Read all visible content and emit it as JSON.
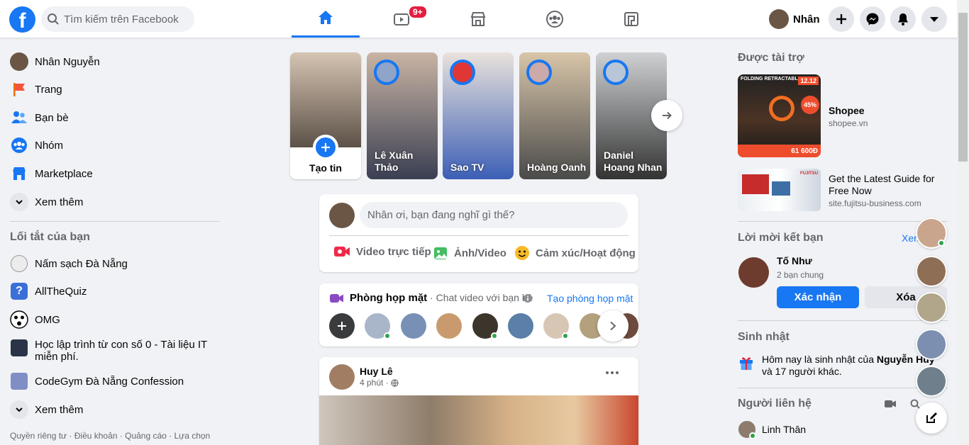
{
  "topbar": {
    "logo": "f",
    "search_placeholder": "Tìm kiếm trên Facebook",
    "video_badge": "9+",
    "user_short_name": "Nhân",
    "tabs": [
      "home-icon",
      "watch-icon",
      "marketplace-icon",
      "groups-icon",
      "gaming-icon"
    ],
    "actions": [
      "plus-icon",
      "messenger-icon",
      "bell-icon",
      "caret-down-icon"
    ]
  },
  "left_nav": {
    "items": [
      {
        "label": "Nhân Nguyễn",
        "icon": "avatar"
      },
      {
        "label": "Trang",
        "icon": "flag-icon"
      },
      {
        "label": "Bạn bè",
        "icon": "friends-icon"
      },
      {
        "label": "Nhóm",
        "icon": "groups-icon"
      },
      {
        "label": "Marketplace",
        "icon": "store-icon"
      },
      {
        "label": "Xem thêm",
        "icon": "chevron-down-icon"
      }
    ],
    "shortcuts_title": "Lối tắt của bạn",
    "shortcuts": [
      {
        "label": "Nấm sạch Đà Nẵng"
      },
      {
        "label": "AllTheQuiz"
      },
      {
        "label": "OMG"
      },
      {
        "label": "Học lập trình từ con số 0 - Tài liệu IT miễn phí."
      },
      {
        "label": "CodeGym Đà Nẵng Confession"
      },
      {
        "label": "Xem thêm"
      }
    ],
    "footer": "Quyền riêng tư · Điều khoản · Quảng cáo · Lựa chọn"
  },
  "stories": [
    {
      "name": "Tạo tin"
    },
    {
      "name": "Lê Xuân Thảo"
    },
    {
      "name": "Sao TV"
    },
    {
      "name": "Hoàng Oanh"
    },
    {
      "name": "Daniel Hoang Nhan"
    }
  ],
  "composer": {
    "placeholder": "Nhân ơi, bạn đang nghĩ gì thế?",
    "actions": [
      {
        "label": "Video trực tiếp",
        "color": "#f02849"
      },
      {
        "label": "Ảnh/Video",
        "color": "#45bd62"
      },
      {
        "label": "Cảm xúc/Hoạt động",
        "color": "#f7b928"
      }
    ]
  },
  "rooms": {
    "title": "Phòng họp mặt",
    "subtitle": " · Chat video với bạn bè",
    "create_link": "Tạo phòng họp mặt"
  },
  "post": {
    "author": "Huy Lê",
    "time": "4 phút ·"
  },
  "right": {
    "sponsored_title": "Được tài trợ",
    "ads": [
      {
        "title": "Shopee",
        "domain": "shopee.vn",
        "image_text": "FOLDING RETRACTABLE LED L",
        "date": "12.12",
        "discount": "45%",
        "price": "61 600Đ"
      },
      {
        "title": "Get the Latest Guide for Free Now",
        "domain": "site.fujitsu-business.com",
        "brand": "FUJITSU"
      }
    ],
    "friend_requests_title": "Lời mời kết bạn",
    "see_all": "Xem",
    "request": {
      "name": "Tố Như",
      "mutual": "2 bạn chung",
      "confirm": "Xác nhận",
      "delete": "Xóa"
    },
    "birthday_title": "Sinh nhật",
    "birthday_prefix": "Hôm nay là sinh nhật của ",
    "birthday_name": "Nguyễn Huy",
    "birthday_suffix": " và 17 người khác.",
    "contacts_title": "Người liên hệ",
    "contacts": [
      {
        "name": "Linh Thân"
      }
    ]
  },
  "colors": {
    "brand": "#1877f2",
    "bg": "#f0f2f5",
    "text_secondary": "#65676b",
    "online": "#31a24c"
  }
}
